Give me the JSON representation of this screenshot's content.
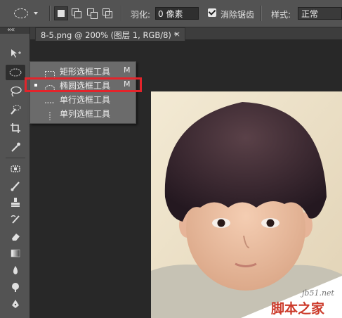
{
  "options_bar": {
    "feather_label": "羽化:",
    "feather_value": "0 像素",
    "antialias_label": "消除锯齿",
    "antialias_checked": true,
    "style_label": "样式:",
    "style_value": "正常"
  },
  "document_tab": {
    "title": "8-5.png @ 200% (图层 1, RGB/8) *",
    "close": "×"
  },
  "toolbox": {
    "collapse_glyph": "««"
  },
  "flyout": {
    "items": [
      {
        "label": "矩形选框工具",
        "shortcut": "M",
        "icon": "rect-marquee-icon",
        "selected": false
      },
      {
        "label": "椭圆选框工具",
        "shortcut": "M",
        "icon": "ellipse-marquee-icon",
        "selected": true
      },
      {
        "label": "单行选框工具",
        "shortcut": "",
        "icon": "single-row-marquee-icon",
        "selected": false
      },
      {
        "label": "单列选框工具",
        "shortcut": "",
        "icon": "single-column-marquee-icon",
        "selected": false
      }
    ]
  },
  "watermark": {
    "site": "jb51.net",
    "brand": "脚本之家"
  },
  "colors": {
    "highlight": "#e3242b",
    "panel": "#535353",
    "background": "#282828"
  }
}
